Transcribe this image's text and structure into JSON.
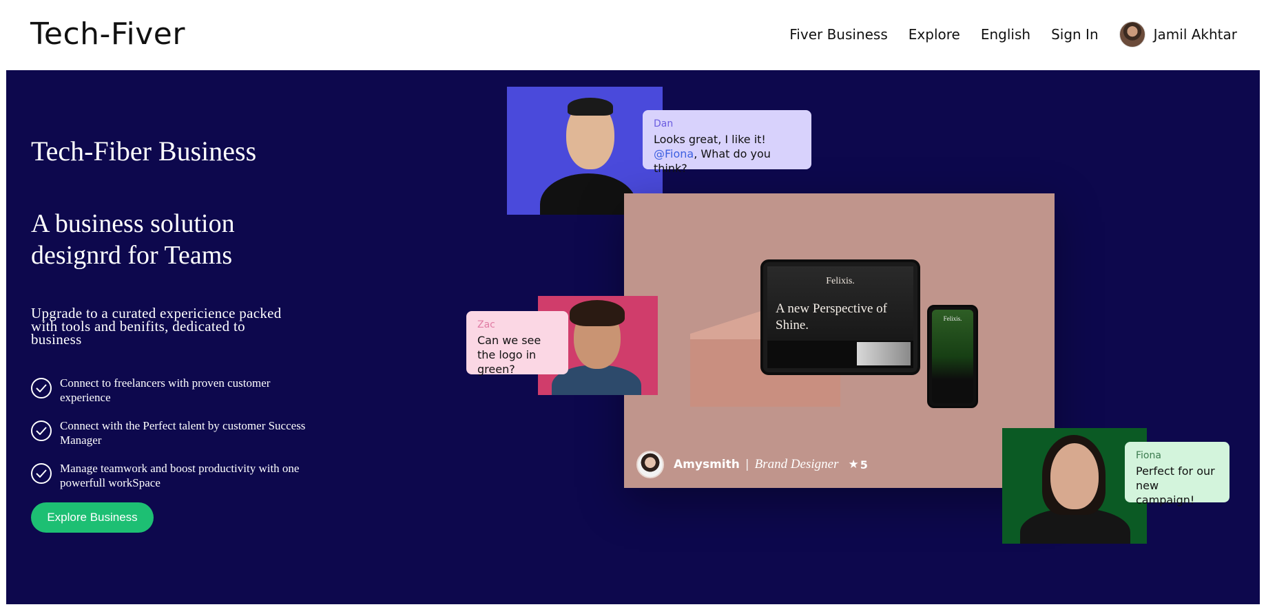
{
  "header": {
    "logo": "Tech-Fiver",
    "nav": {
      "business": "Fiver Business",
      "explore": "Explore",
      "language": "English",
      "signin": "Sign In",
      "user_name": "Jamil Akhtar"
    }
  },
  "hero": {
    "eyebrow": "Tech-Fiber Business",
    "headline": "A business solution designrd for Teams",
    "subheading": "Upgrade to a curated expericience packed with tools and benifits, dedicated to business",
    "features": [
      {
        "text": "Connect to freelancers with proven customer experience"
      },
      {
        "text": "Connect with the Perfect talent by customer Success Manager"
      },
      {
        "text": "Manage teamwork and boost productivity with one powerfull workSpace"
      }
    ],
    "cta_label": "Explore Business"
  },
  "bubbles": {
    "dan": {
      "name": "Dan",
      "line1": "Looks great, I like it!",
      "mention": "@Fiona",
      "line2_rest": ", What do you think?"
    },
    "zac": {
      "name": "Zac",
      "message": "Can we see the logo in green?"
    },
    "fiona": {
      "name": "Fiona",
      "message": "Perfect for our new campaign!"
    }
  },
  "showcase": {
    "tablet_brand": "Felixis.",
    "tablet_title": "A new Perspective of Shine.",
    "phone_brand": "Felixis.",
    "seller_name": "Amysmith",
    "separator": "|",
    "seller_role": "Brand Designer",
    "star_glyph": "★",
    "rating": "5"
  },
  "colors": {
    "hero_bg": "#0d084d",
    "cta_green": "#1dbf73",
    "card_bg": "#c0958c"
  }
}
